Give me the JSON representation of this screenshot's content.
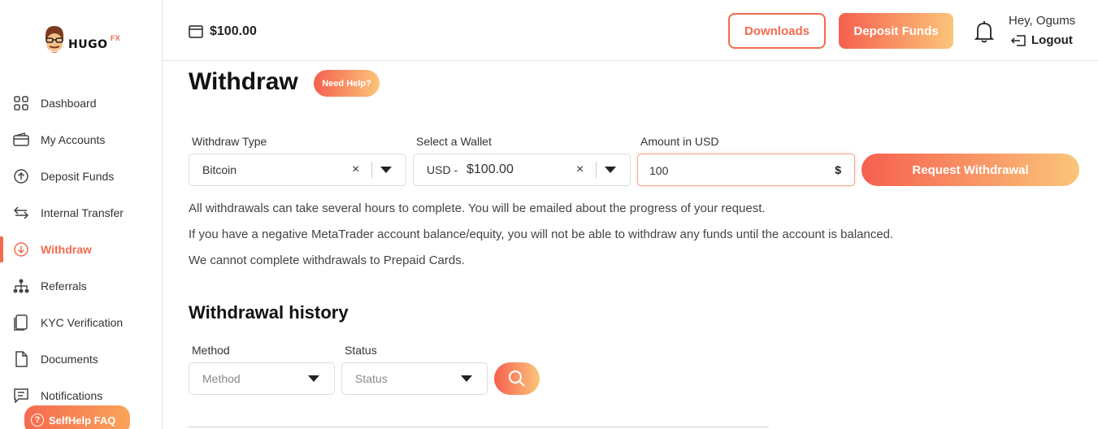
{
  "brand": {
    "name": "HUGO",
    "suffix": "FX"
  },
  "sidebar": {
    "items": [
      {
        "label": "Dashboard",
        "icon": "grid-icon"
      },
      {
        "label": "My Accounts",
        "icon": "wallet-icon"
      },
      {
        "label": "Deposit Funds",
        "icon": "arrow-up-circle-icon"
      },
      {
        "label": "Internal Transfer",
        "icon": "transfer-icon"
      },
      {
        "label": "Withdraw",
        "icon": "arrow-down-circle-icon",
        "active": true
      },
      {
        "label": "Referrals",
        "icon": "hierarchy-icon"
      },
      {
        "label": "KYC Verification",
        "icon": "id-card-icon"
      },
      {
        "label": "Documents",
        "icon": "document-icon"
      },
      {
        "label": "Notifications",
        "icon": "message-icon"
      }
    ],
    "selfhelp_label": "SelfHelp FAQ"
  },
  "header": {
    "balance": "$100.00",
    "downloads_label": "Downloads",
    "deposit_label": "Deposit Funds",
    "greeting": "Hey, Ogums",
    "logout_label": "Logout"
  },
  "withdraw": {
    "title": "Withdraw",
    "help_label": "Need Help?",
    "type_label": "Withdraw Type",
    "type_value": "Bitcoin",
    "wallet_label": "Select a Wallet",
    "wallet_prefix": "USD -",
    "wallet_value": "$100.00",
    "amount_label": "Amount in USD",
    "amount_value": "100",
    "amount_currency": "$",
    "request_label": "Request Withdrawal",
    "info": [
      "All withdrawals can take several hours to complete. You will be emailed about the progress of your request.",
      "If you have a negative MetaTrader account balance/equity, you will not be able to withdraw any funds until the account is balanced.",
      "We cannot complete withdrawals to Prepaid Cards."
    ]
  },
  "history": {
    "title": "Withdrawal history",
    "method_label": "Method",
    "method_placeholder": "Method",
    "status_label": "Status",
    "status_placeholder": "Status"
  },
  "colors": {
    "accent": "#f26b4e",
    "gradient_start": "#f6604f",
    "gradient_end": "#fbc57a"
  }
}
